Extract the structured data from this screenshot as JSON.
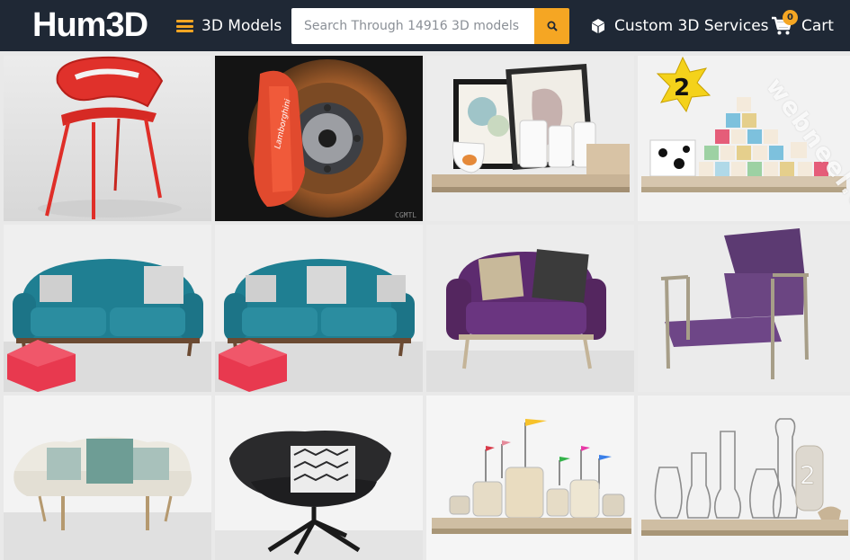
{
  "header": {
    "logo_text": "Hum3D",
    "menu_label": "3D Models",
    "search_placeholder": "Search Through 14916 3D models",
    "services_label": "Custom 3D Services",
    "cart_label": "Cart",
    "cart_count": "0"
  },
  "products": [
    {
      "name": "red-chair",
      "bg": "#e4e4e4"
    },
    {
      "name": "brake-disc",
      "bg": "#111111",
      "caption": "CGMTL"
    },
    {
      "name": "shelf-with-pictures-and-cups",
      "bg": "#ececec"
    },
    {
      "name": "shelf-with-toy-blocks",
      "bg": "#f2f2f2",
      "topper_digit": "2"
    },
    {
      "name": "teal-sofa",
      "bg": "#eeeeee"
    },
    {
      "name": "teal-sofa-copy",
      "bg": "#eeeeee"
    },
    {
      "name": "purple-armchair",
      "bg": "#ececec"
    },
    {
      "name": "purple-lounge-chair",
      "bg": "#ebebeb"
    },
    {
      "name": "white-loveseat",
      "bg": "#f3f3f3"
    },
    {
      "name": "black-swan-chair",
      "bg": "#f3f3f3"
    },
    {
      "name": "shelf-with-jars-and-flags",
      "bg": "#f5f5f5"
    },
    {
      "name": "shelf-with-glass-vases",
      "bg": "#f2f2f2",
      "vase_digit": "2"
    }
  ],
  "watermark": "webneel.com",
  "colors": {
    "header_bg": "#1f2835",
    "accent": "#f5a623",
    "teal": "#1f7f92",
    "purple": "#5d2b6f"
  }
}
